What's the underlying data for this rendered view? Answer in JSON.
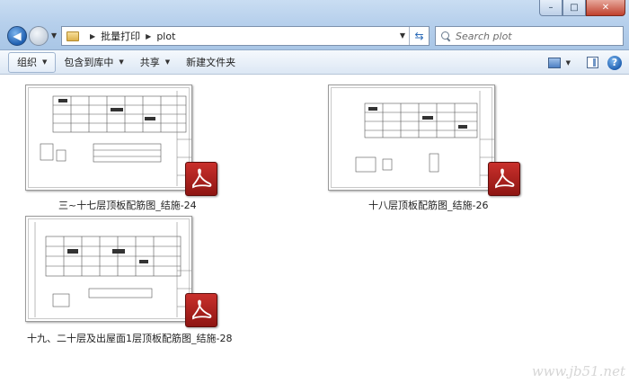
{
  "window": {
    "controls": {
      "minimize": "–",
      "maximize": "□",
      "close": "✕"
    }
  },
  "address": {
    "crumbs": [
      "批量打印",
      "plot"
    ]
  },
  "search": {
    "placeholder": "Search plot"
  },
  "toolbar": {
    "organize": "组织",
    "include_library": "包含到库中",
    "share": "共享",
    "new_folder": "新建文件夹"
  },
  "files": [
    {
      "name": "三~十七层顶板配筋图_结施-24",
      "icon": "pdf-icon"
    },
    {
      "name": "十八层顶板配筋图_结施-26",
      "icon": "pdf-icon"
    },
    {
      "name": "十九、二十层及出屋面1层顶板配筋图_结施-28",
      "icon": "pdf-icon"
    }
  ],
  "colors": {
    "pdf_red": "#b3231f",
    "chrome_blue": "#b7d0ec"
  },
  "watermark": "www.jb51.net"
}
